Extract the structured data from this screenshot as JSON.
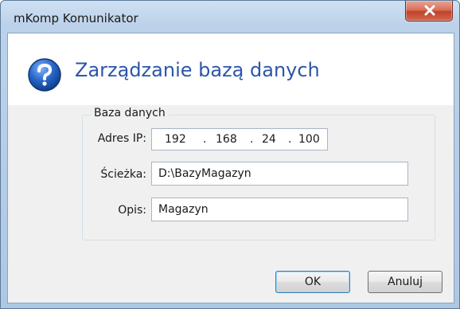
{
  "window": {
    "title": "mKomp Komunikator"
  },
  "header": {
    "title": "Zarządzanie bazą danych",
    "icon": "question-icon"
  },
  "group": {
    "legend": "Baza danych",
    "ip": {
      "label": "Adres IP:",
      "octets": [
        "192",
        "168",
        "24",
        "100"
      ],
      "separator": "."
    },
    "path": {
      "label": "Ścieżka:",
      "value": "D:\\BazyMagazyn"
    },
    "description": {
      "label": "Opis:",
      "value": "Magazyn"
    }
  },
  "buttons": {
    "ok": "OK",
    "cancel": "Anuluj"
  },
  "colors": {
    "header_title": "#2c56a8",
    "close_button": "#c1432c",
    "help_icon": "#1f5fbf"
  }
}
